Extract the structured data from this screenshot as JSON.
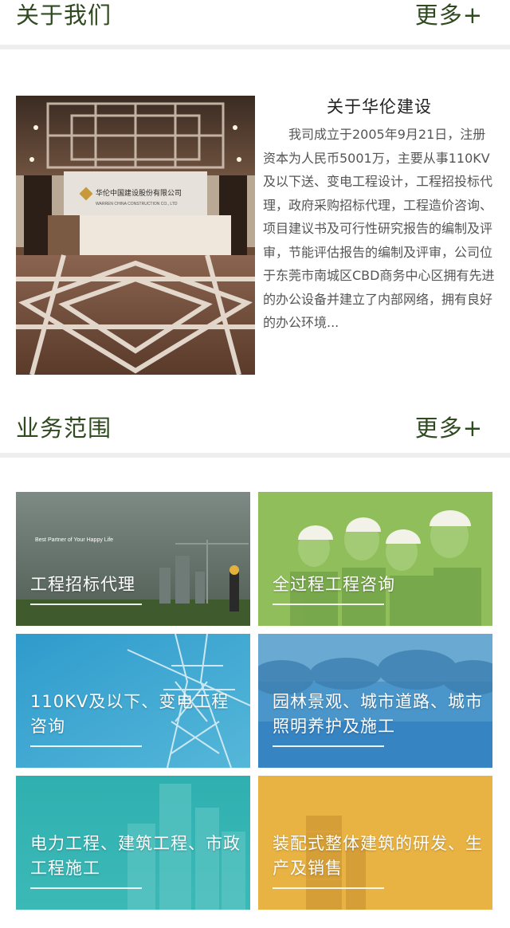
{
  "about_section": {
    "heading": "关于我们",
    "more_label": "更多+",
    "title": "关于华伦建设",
    "body": "我司成立于2005年9月21日，注册资本为人民币5001万，主要从事110KV 及以下送、变电工程设计，工程招投标代理，政府采购招标代理，工程造价咨询、 项目建议书及可行性研究报告的编制及评审，节能评估报告的编制及评审，公司位于东莞市南城区CBD商务中心区拥有先进的办公设备并建立了内部网络，拥有良好的办公环境..."
  },
  "services_section": {
    "heading": "业务范围",
    "more_label": "更多+",
    "tiles": [
      {
        "label": "工程招标代理",
        "color": "#5f6e63"
      },
      {
        "label": "全过程工程咨询",
        "color": "#8fbe5a"
      },
      {
        "label": "110KV及以下、变电工程咨询",
        "color": "#3aa3cf"
      },
      {
        "label": "园林景观、城市道路、城市照明养护及施工",
        "color": "#3f8fcc"
      },
      {
        "label": "电力工程、建筑工程、市政工程施工",
        "color": "#33b2b5"
      },
      {
        "label": "装配式整体建筑的研发、生产及销售",
        "color": "#e9b343"
      }
    ]
  },
  "photo_text": {
    "sign_cn": "华伦中国建设股份有限公司",
    "sign_en": "WARREN CHINA CONSTRUCTION CO., LTD"
  },
  "tile1_overlay_text": "Best Partner of Your Happy Life"
}
